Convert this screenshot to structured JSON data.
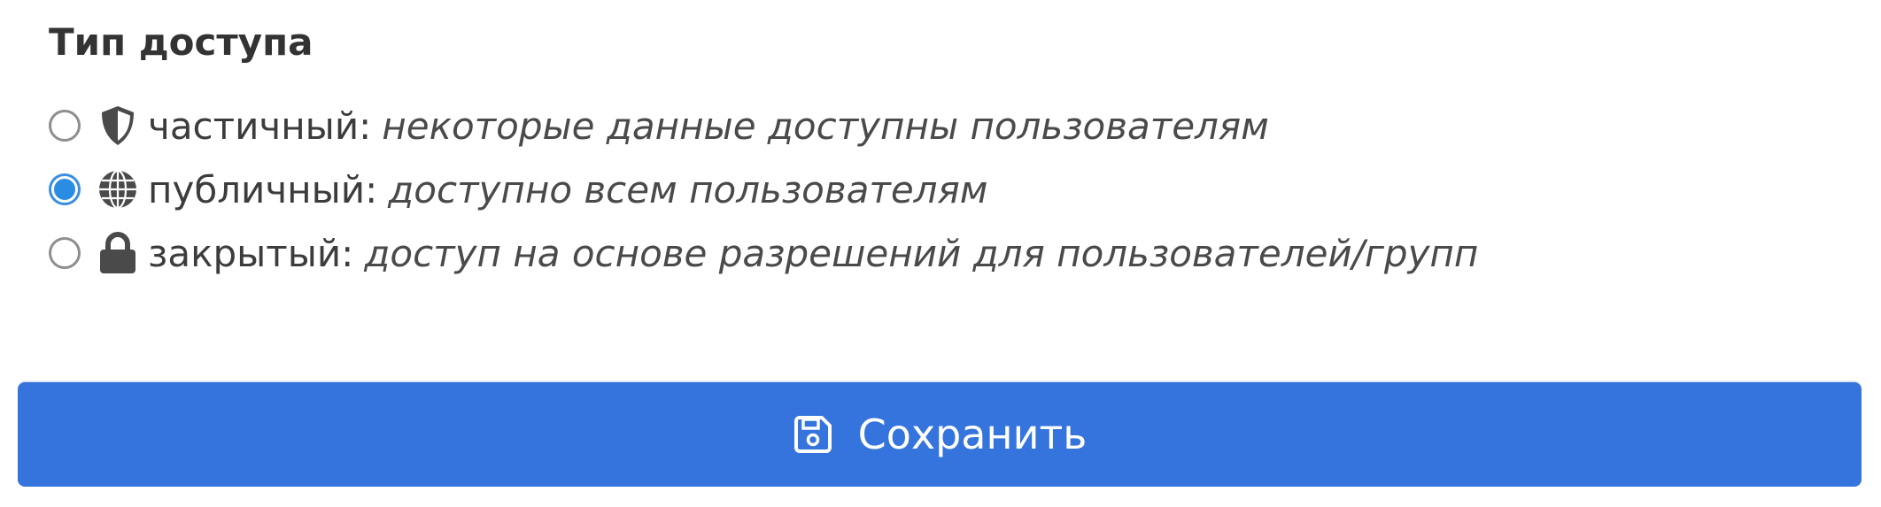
{
  "section": {
    "title": "Тип доступа"
  },
  "access_options": [
    {
      "name": "частичный:",
      "description": "некоторые данные доступны пользователям",
      "icon": "shield-icon",
      "selected": false
    },
    {
      "name": "публичный:",
      "description": "доступно всем пользователям",
      "icon": "globe-icon",
      "selected": true
    },
    {
      "name": "закрытый:",
      "description": "доступ на основе разрешений для пользователей/групп",
      "icon": "lock-icon",
      "selected": false
    }
  ],
  "save_button": {
    "label": "Сохранить",
    "icon": "floppy-disk-icon"
  },
  "colors": {
    "primary": "#3474dc",
    "radio_checked": "#2b8ce3",
    "text": "#3c3c3c",
    "icon": "#4a4a4a"
  }
}
